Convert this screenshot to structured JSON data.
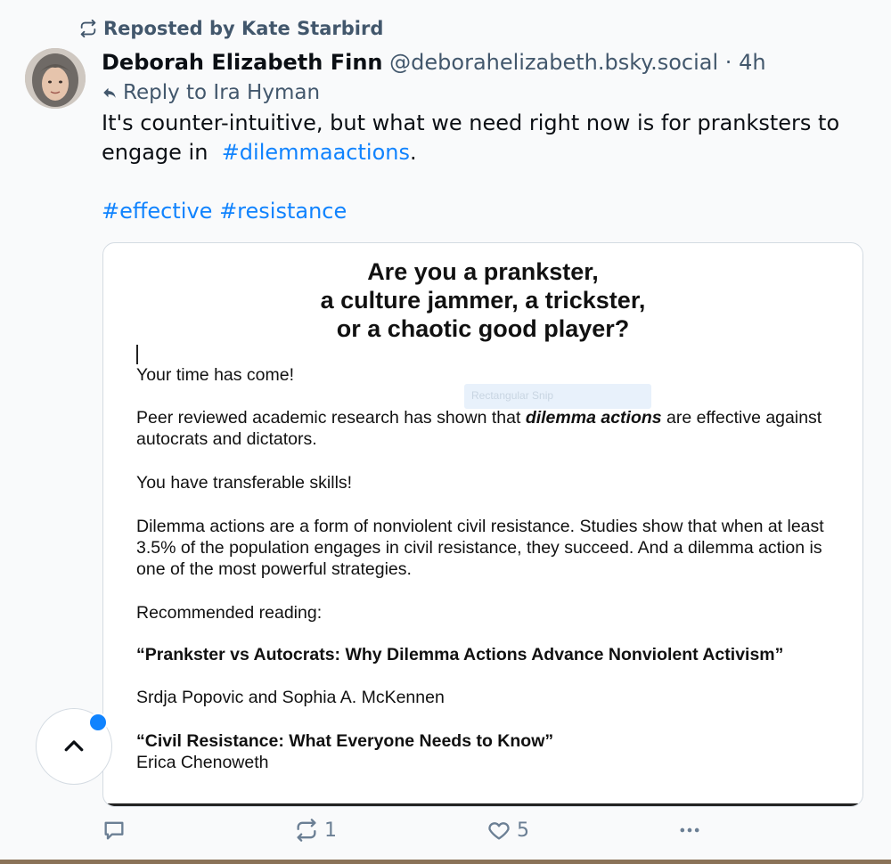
{
  "repost": {
    "label": "Reposted by Kate Starbird",
    "icon": "repost-icon"
  },
  "post": {
    "author_name": "Deborah Elizabeth Finn",
    "author_handle": "@deborahelizabeth.bsky.social",
    "separator": "·",
    "time": "4h",
    "reply_to": "Reply to Ira Hyman",
    "text_line1": "It's counter-intuitive, but what we need right now is for pranksters to",
    "text_line2_prefix": "engage in  ",
    "hashtag1": "#dilemmaactions",
    "text_line2_suffix": ".",
    "hashtag2": "#effective",
    "hashtag3": "#resistance"
  },
  "embed_image": {
    "title_line1": "Are you a prankster,",
    "title_line2": "a culture jammer, a trickster,",
    "title_line3": "or a chaotic good player?",
    "ghost_label": "Rectangular Snip",
    "p1": "Your time has come!",
    "p2_before": "Peer reviewed academic research has shown that ",
    "p2_em": "dilemma actions",
    "p2_after": " are effective against autocrats and dictators.",
    "p3": "You have  transferable skills!",
    "p4": "Dilemma actions are a form of nonviolent civil resistance. Studies show that when at least 3.5% of the population engages in civil resistance, they succeed.  And a dilemma action is one of the most powerful strategies.",
    "p5": "Recommended reading:",
    "book1_title": "“Prankster vs Autocrats:  Why Dilemma Actions Advance Nonviolent Activism”",
    "book1_authors": "Srdja Popovic and Sophia A. McKennen",
    "book2_title": "“Civil Resistance:  What Everyone Needs to Know”",
    "book2_author": "Erica Chenoweth"
  },
  "actions": {
    "reply_count": "",
    "repost_count": "1",
    "like_count": "5"
  },
  "colors": {
    "link": "#1083fe",
    "muted": "#42576c",
    "accent_dot": "#1083fe"
  }
}
